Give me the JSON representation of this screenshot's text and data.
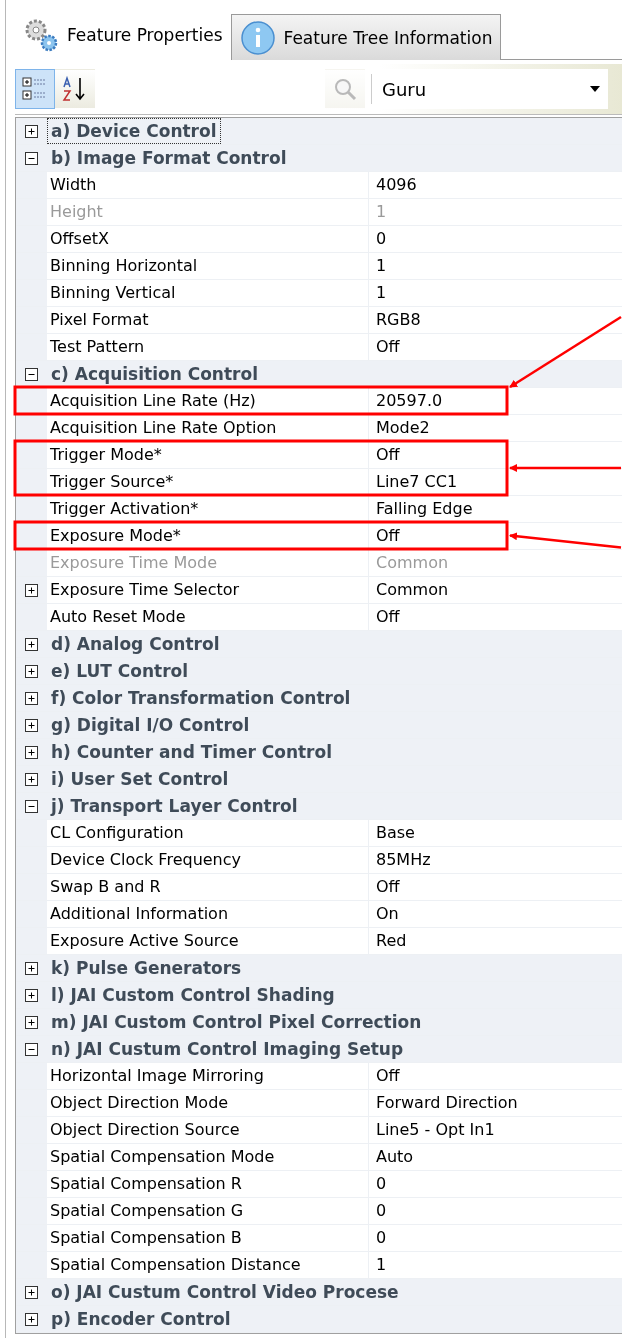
{
  "tabs": [
    {
      "label": "Feature Properties",
      "selected": true
    },
    {
      "label": "Feature Tree Information",
      "selected": false
    }
  ],
  "toolbar": {
    "categorized": {
      "selected": true
    },
    "alphabetical": {
      "selected": false
    },
    "search": {
      "disabled": true
    },
    "visibility": {
      "value": "Guru"
    }
  },
  "categories": [
    {
      "label": "a) Device Control",
      "expanded": false,
      "selected": true
    },
    {
      "label": "b) Image Format Control",
      "expanded": true,
      "selected": false,
      "children": [
        {
          "name": "Width",
          "value": "4096",
          "disabled": false
        },
        {
          "name": "Height",
          "value": "1",
          "disabled": true
        },
        {
          "name": "OffsetX",
          "value": "0",
          "disabled": false
        },
        {
          "name": "Binning Horizontal",
          "value": "1",
          "disabled": false
        },
        {
          "name": "Binning Vertical",
          "value": "1",
          "disabled": false
        },
        {
          "name": "Pixel Format",
          "value": "RGB8",
          "disabled": false
        },
        {
          "name": "Test Pattern",
          "value": "Off",
          "disabled": false
        }
      ]
    },
    {
      "label": "c) Acquisition Control",
      "expanded": true,
      "selected": false,
      "children": [
        {
          "name": "Acquisition Line Rate (Hz)",
          "value": "20597.0",
          "disabled": false,
          "highlighted": true
        },
        {
          "name": "Acquisition Line Rate Option",
          "value": "Mode2",
          "disabled": false
        },
        {
          "name": "Trigger Mode*",
          "value": "Off",
          "disabled": false,
          "highlighted": true
        },
        {
          "name": "Trigger Source*",
          "value": "Line7 CC1",
          "disabled": false,
          "highlighted": true
        },
        {
          "name": "Trigger Activation*",
          "value": "Falling Edge",
          "disabled": false
        },
        {
          "name": "Exposure Mode*",
          "value": "Off",
          "disabled": false,
          "highlighted": true
        },
        {
          "name": "Exposure Time Mode",
          "value": "Common",
          "disabled": true
        },
        {
          "name": "Exposure Time Selector",
          "value": "Common",
          "disabled": false,
          "expanded": false
        },
        {
          "name": "Auto Reset Mode",
          "value": "Off",
          "disabled": false
        }
      ]
    },
    {
      "label": "d) Analog Control",
      "expanded": false,
      "selected": false
    },
    {
      "label": "e) LUT Control",
      "expanded": false,
      "selected": false
    },
    {
      "label": "f) Color Transformation Control",
      "expanded": false,
      "selected": false
    },
    {
      "label": "g) Digital I/O Control",
      "expanded": false,
      "selected": false
    },
    {
      "label": "h) Counter and Timer Control",
      "expanded": false,
      "selected": false
    },
    {
      "label": "i) User Set Control",
      "expanded": false,
      "selected": false
    },
    {
      "label": "j) Transport Layer Control",
      "expanded": true,
      "selected": false,
      "children": [
        {
          "name": "CL Configuration",
          "value": "Base",
          "disabled": false
        },
        {
          "name": "Device Clock Frequency",
          "value": "85MHz",
          "disabled": false
        },
        {
          "name": "Swap B and R",
          "value": "Off",
          "disabled": false
        },
        {
          "name": "Additional Information",
          "value": "On",
          "disabled": false
        },
        {
          "name": "Exposure Active Source",
          "value": "Red",
          "disabled": false
        }
      ]
    },
    {
      "label": "k) Pulse Generators",
      "expanded": false,
      "selected": false
    },
    {
      "label": "l) JAI Custom Control Shading",
      "expanded": false,
      "selected": false
    },
    {
      "label": "m) JAI Custom Control Pixel Correction",
      "expanded": false,
      "selected": false
    },
    {
      "label": "n) JAI Custum Control Imaging Setup",
      "expanded": true,
      "selected": false,
      "children": [
        {
          "name": "Horizontal Image Mirroring",
          "value": "Off",
          "disabled": false
        },
        {
          "name": "Object Direction Mode",
          "value": "Forward Direction",
          "disabled": false
        },
        {
          "name": "Object Direction Source",
          "value": "Line5 - Opt In1",
          "disabled": false
        },
        {
          "name": "Spatial Compensation Mode",
          "value": "Auto",
          "disabled": false
        },
        {
          "name": "Spatial Compensation R",
          "value": "0",
          "disabled": false
        },
        {
          "name": "Spatial Compensation G",
          "value": "0",
          "disabled": false
        },
        {
          "name": "Spatial Compensation B",
          "value": "0",
          "disabled": false
        },
        {
          "name": "Spatial Compensation Distance",
          "value": "1",
          "disabled": false
        }
      ]
    },
    {
      "label": "o) JAI Custum Control Video Procese",
      "expanded": false,
      "selected": false
    },
    {
      "label": "p) Encoder Control",
      "expanded": false,
      "selected": false
    }
  ]
}
